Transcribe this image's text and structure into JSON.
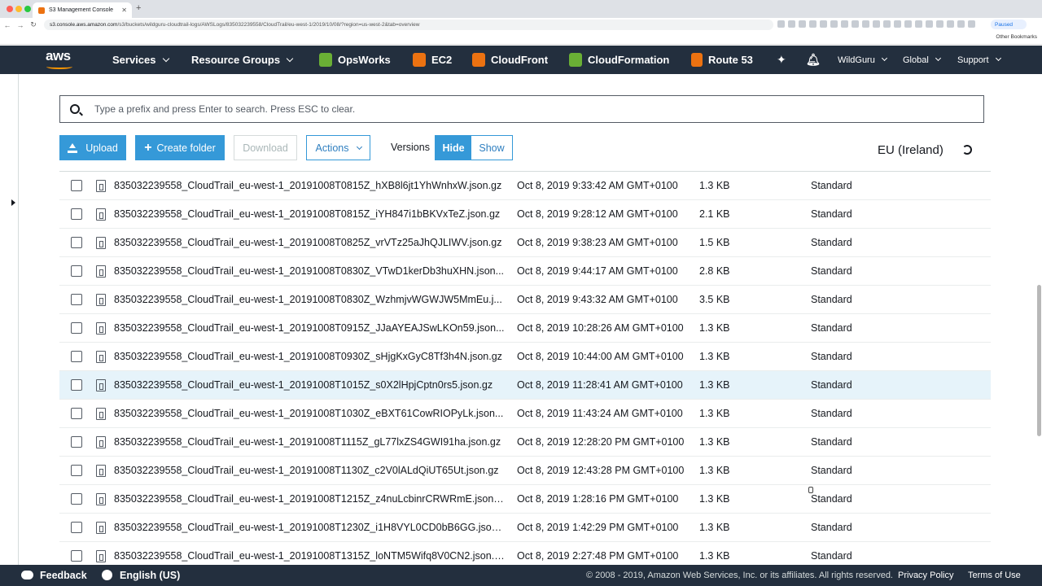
{
  "browser": {
    "tab_title": "S3 Management Console",
    "url_host": "s3.console.aws.amazon.com",
    "url_path": "/s3/buckets/wildguru-cloudtrail-logs/AWSLogs/835032239558/CloudTrail/eu-west-1/2019/10/08/?region=us-west-2&tab=overview",
    "paused_label": "Paused",
    "other_bookmarks": "Other Bookmarks"
  },
  "nav": {
    "logo": "aws",
    "services": "Services",
    "resource_groups": "Resource Groups",
    "shortcuts": [
      {
        "label": "OpsWorks",
        "color": "#6aaf35"
      },
      {
        "label": "EC2",
        "color": "#ec7211"
      },
      {
        "label": "CloudFront",
        "color": "#ec7211"
      },
      {
        "label": "CloudFormation",
        "color": "#6aaf35"
      },
      {
        "label": "Route 53",
        "color": "#ec7211"
      }
    ],
    "account": "WildGuru",
    "region": "Global",
    "support": "Support"
  },
  "search": {
    "placeholder": "Type a prefix and press Enter to search. Press ESC to clear."
  },
  "toolbar": {
    "upload": "Upload",
    "create_folder": "Create folder",
    "download": "Download",
    "actions": "Actions",
    "versions_label": "Versions",
    "hide": "Hide",
    "show": "Show",
    "region": "EU (Ireland)"
  },
  "objects": [
    {
      "name": "835032239558_CloudTrail_eu-west-1_20191008T0815Z_hXB8l6jt1YhWnhxW.json.gz",
      "date": "Oct 8, 2019 9:33:42 AM GMT+0100",
      "size": "1.3 KB",
      "storage": "Standard"
    },
    {
      "name": "835032239558_CloudTrail_eu-west-1_20191008T0815Z_iYH847i1bBKVxTeZ.json.gz",
      "date": "Oct 8, 2019 9:28:12 AM GMT+0100",
      "size": "2.1 KB",
      "storage": "Standard"
    },
    {
      "name": "835032239558_CloudTrail_eu-west-1_20191008T0825Z_vrVTz25aJhQJLIWV.json.gz",
      "date": "Oct 8, 2019 9:38:23 AM GMT+0100",
      "size": "1.5 KB",
      "storage": "Standard"
    },
    {
      "name": "835032239558_CloudTrail_eu-west-1_20191008T0830Z_VTwD1kerDb3huXHN.json...",
      "date": "Oct 8, 2019 9:44:17 AM GMT+0100",
      "size": "2.8 KB",
      "storage": "Standard"
    },
    {
      "name": "835032239558_CloudTrail_eu-west-1_20191008T0830Z_WzhmjvWGWJW5MmEu.j...",
      "date": "Oct 8, 2019 9:43:32 AM GMT+0100",
      "size": "3.5 KB",
      "storage": "Standard"
    },
    {
      "name": "835032239558_CloudTrail_eu-west-1_20191008T0915Z_JJaAYEAJSwLKOn59.json...",
      "date": "Oct 8, 2019 10:28:26 AM GMT+0100",
      "size": "1.3 KB",
      "storage": "Standard"
    },
    {
      "name": "835032239558_CloudTrail_eu-west-1_20191008T0930Z_sHjgKxGyC8Tf3h4N.json.gz",
      "date": "Oct 8, 2019 10:44:00 AM GMT+0100",
      "size": "1.3 KB",
      "storage": "Standard"
    },
    {
      "name": "835032239558_CloudTrail_eu-west-1_20191008T1015Z_s0X2lHpjCptn0rs5.json.gz",
      "date": "Oct 8, 2019 11:28:41 AM GMT+0100",
      "size": "1.3 KB",
      "storage": "Standard",
      "highlighted": true
    },
    {
      "name": "835032239558_CloudTrail_eu-west-1_20191008T1030Z_eBXT61CowRIOPyLk.json...",
      "date": "Oct 8, 2019 11:43:24 AM GMT+0100",
      "size": "1.3 KB",
      "storage": "Standard"
    },
    {
      "name": "835032239558_CloudTrail_eu-west-1_20191008T1115Z_gL77lxZS4GWI91ha.json.gz",
      "date": "Oct 8, 2019 12:28:20 PM GMT+0100",
      "size": "1.3 KB",
      "storage": "Standard"
    },
    {
      "name": "835032239558_CloudTrail_eu-west-1_20191008T1130Z_c2V0lALdQiUT65Ut.json.gz",
      "date": "Oct 8, 2019 12:43:28 PM GMT+0100",
      "size": "1.3 KB",
      "storage": "Standard"
    },
    {
      "name": "835032239558_CloudTrail_eu-west-1_20191008T1215Z_z4nuLcbinrCRWRmE.json....",
      "date": "Oct 8, 2019 1:28:16 PM GMT+0100",
      "size": "1.3 KB",
      "storage": "Standard"
    },
    {
      "name": "835032239558_CloudTrail_eu-west-1_20191008T1230Z_i1H8VYL0CD0bB6GG.json...",
      "date": "Oct 8, 2019 1:42:29 PM GMT+0100",
      "size": "1.3 KB",
      "storage": "Standard"
    },
    {
      "name": "835032239558_CloudTrail_eu-west-1_20191008T1315Z_loNTM5Wifq8V0CN2.json.gz",
      "date": "Oct 8, 2019 2:27:48 PM GMT+0100",
      "size": "1.3 KB",
      "storage": "Standard"
    }
  ],
  "footer": {
    "feedback": "Feedback",
    "language": "English (US)",
    "copyright": "© 2008 - 2019, Amazon Web Services, Inc. or its affiliates. All rights reserved.",
    "privacy": "Privacy Policy",
    "terms": "Terms of Use"
  },
  "colors": {
    "nav_bg": "#232f3e",
    "primary_button": "#3599d8",
    "highlight_row": "#e6f3fa"
  }
}
